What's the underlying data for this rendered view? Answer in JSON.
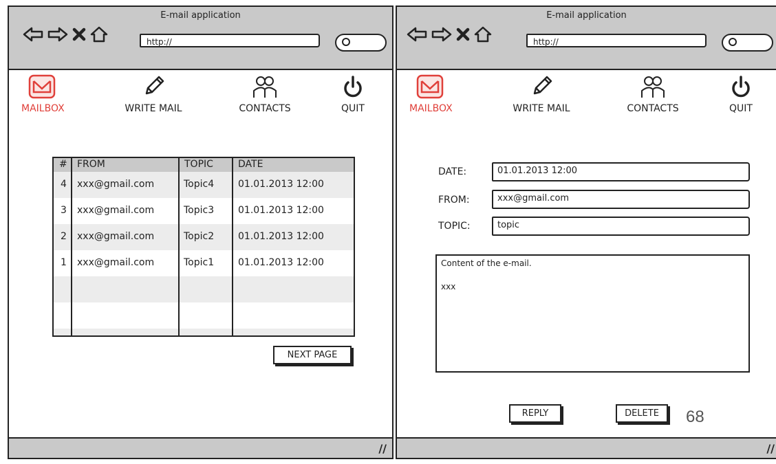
{
  "window_left": {
    "title": "E-mail application",
    "url": "http://",
    "toolbar": {
      "mailbox": "MAILBOX",
      "write_mail": "WRITE MAIL",
      "contacts": "CONTACTS",
      "quit": "QUIT"
    },
    "table": {
      "headers": [
        "#",
        "FROM",
        "TOPIC",
        "DATE"
      ],
      "rows": [
        {
          "num": "4",
          "from": "xxx@gmail.com",
          "topic": "Topic4",
          "date": "01.01.2013 12:00"
        },
        {
          "num": "3",
          "from": "xxx@gmail.com",
          "topic": "Topic3",
          "date": "01.01.2013 12:00"
        },
        {
          "num": "2",
          "from": "xxx@gmail.com",
          "topic": "Topic2",
          "date": "01.01.2013 12:00"
        },
        {
          "num": "1",
          "from": "xxx@gmail.com",
          "topic": "Topic1",
          "date": "01.01.2013 12:00"
        }
      ]
    },
    "next_page": "NEXT PAGE"
  },
  "window_right": {
    "title": "E-mail application",
    "url": "http://",
    "toolbar": {
      "mailbox": "MAILBOX",
      "write_mail": "WRITE MAIL",
      "contacts": "CONTACTS",
      "quit": "QUIT"
    },
    "form": {
      "date_label": "DATE:",
      "date_value": "01.01.2013 12:00",
      "from_label": "FROM:",
      "from_value": "xxx@gmail.com",
      "topic_label": "TOPIC:",
      "topic_value": "topic",
      "content_line1": "Content of the e-mail.",
      "content_line2": "xxx"
    },
    "reply": "REPLY",
    "delete": "DELETE"
  },
  "page_number": "68",
  "colors": {
    "accent": "#e0403a",
    "chrome": "#c9c9c9"
  },
  "icons": [
    "back-arrow-icon",
    "forward-arrow-icon",
    "stop-icon",
    "home-icon",
    "search-icon",
    "mailbox-icon",
    "pencil-icon",
    "contacts-icon",
    "power-icon",
    "resize-grip-icon"
  ]
}
